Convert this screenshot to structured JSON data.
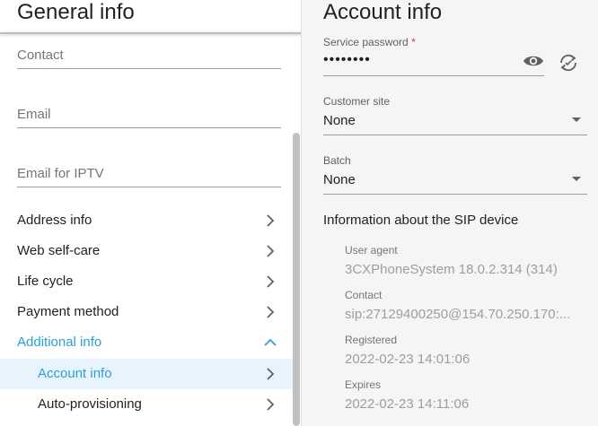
{
  "general": {
    "title": "General info",
    "fields": [
      {
        "placeholder": "Contact"
      },
      {
        "placeholder": "Email"
      },
      {
        "placeholder": "Email for IPTV"
      }
    ],
    "nav": [
      {
        "label": "Address info"
      },
      {
        "label": "Web self-care"
      },
      {
        "label": "Life cycle"
      },
      {
        "label": "Payment method"
      },
      {
        "label": "Additional info"
      },
      {
        "label": "Account info"
      },
      {
        "label": "Auto-provisioning"
      }
    ]
  },
  "account": {
    "title": "Account info",
    "service_password": {
      "label": "Service password",
      "required_mark": "*",
      "value": "••••••••"
    },
    "customer_site": {
      "label": "Customer site",
      "value": "None"
    },
    "batch": {
      "label": "Batch",
      "value": "None"
    },
    "sip": {
      "heading": "Information about the SIP device",
      "user_agent_label": "User agent",
      "user_agent_value": "3CXPhoneSystem 18.0.2.314 (314)",
      "contact_label": "Contact",
      "contact_value": "sip:27129400250@154.70.250.170:...",
      "registered_label": "Registered",
      "registered_value": "2022-02-23 14:01:06",
      "expires_label": "Expires",
      "expires_value": "2022-02-23 14:11:06"
    }
  },
  "colors": {
    "accent": "#2a9fd6",
    "selected_bg": "#e8f4fd",
    "right_bg": "#f5f5f5"
  }
}
